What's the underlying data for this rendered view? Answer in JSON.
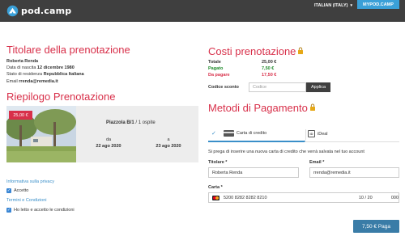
{
  "header": {
    "logo_text": "pod.camp",
    "language": "ITALIAN (ITALY)",
    "mypodcamp_label": "MYPOD.CAMP"
  },
  "titolare": {
    "title": "Titolare della prenotazione",
    "name": "Roberta Renda",
    "birth_label": "Data di nascita",
    "birth_value": "12 dicembre 1980",
    "residence_label": "Stato di residenza",
    "residence_value": "Repubblica Italiana",
    "email_label": "Email",
    "email_value": "rrenda@remedia.it"
  },
  "riepilogo": {
    "title": "Riepilogo Prenotazione",
    "price_tag": "25,00 €",
    "pitch": "Piazzola B/1",
    "guests": "ospite",
    "from_label": "da",
    "from_date": "22 ago 2020",
    "to_label": "a",
    "to_date": "23 ago 2020"
  },
  "privacy": {
    "privacy_link": "Informativa sulla privacy",
    "privacy_check": "Accetto",
    "terms_link": "Termini e Condizioni",
    "terms_check": "Ho letto e accetto le condizioni"
  },
  "costi": {
    "title": "Costi prenotazione",
    "rows": [
      {
        "label": "Totale",
        "value": "25,00 €"
      },
      {
        "label": "Pagato",
        "value": "7,50 €"
      },
      {
        "label": "Da pagare",
        "value": "17,50 €"
      }
    ],
    "discount_label": "Codice sconto",
    "discount_placeholder": "Codice",
    "apply_label": "Applica"
  },
  "pagamento": {
    "title": "Metodi di Pagamento",
    "tab_card": "Carta di credito",
    "tab_ideal": "iDeal",
    "note": "Si prega di inserire una nuova carta di credito che verrà salvata nel tuo account",
    "holder_label": "Titolare *",
    "holder_value": "Roberta Renda",
    "email_label": "Email *",
    "email_value": "rrenda@remedia.it",
    "card_label": "Carta *",
    "card_number": "5200 8282 8282 8210",
    "card_expiry": "10 / 20",
    "card_cvc": "000",
    "pay_button": "7,50 € Paga"
  },
  "colors": {
    "header_bg": "#3f3f3f",
    "accent_red": "#d8304a",
    "accent_blue": "#3a8fc9",
    "paid_green": "#1e8a2a",
    "pay_button": "#3a7ca7"
  }
}
